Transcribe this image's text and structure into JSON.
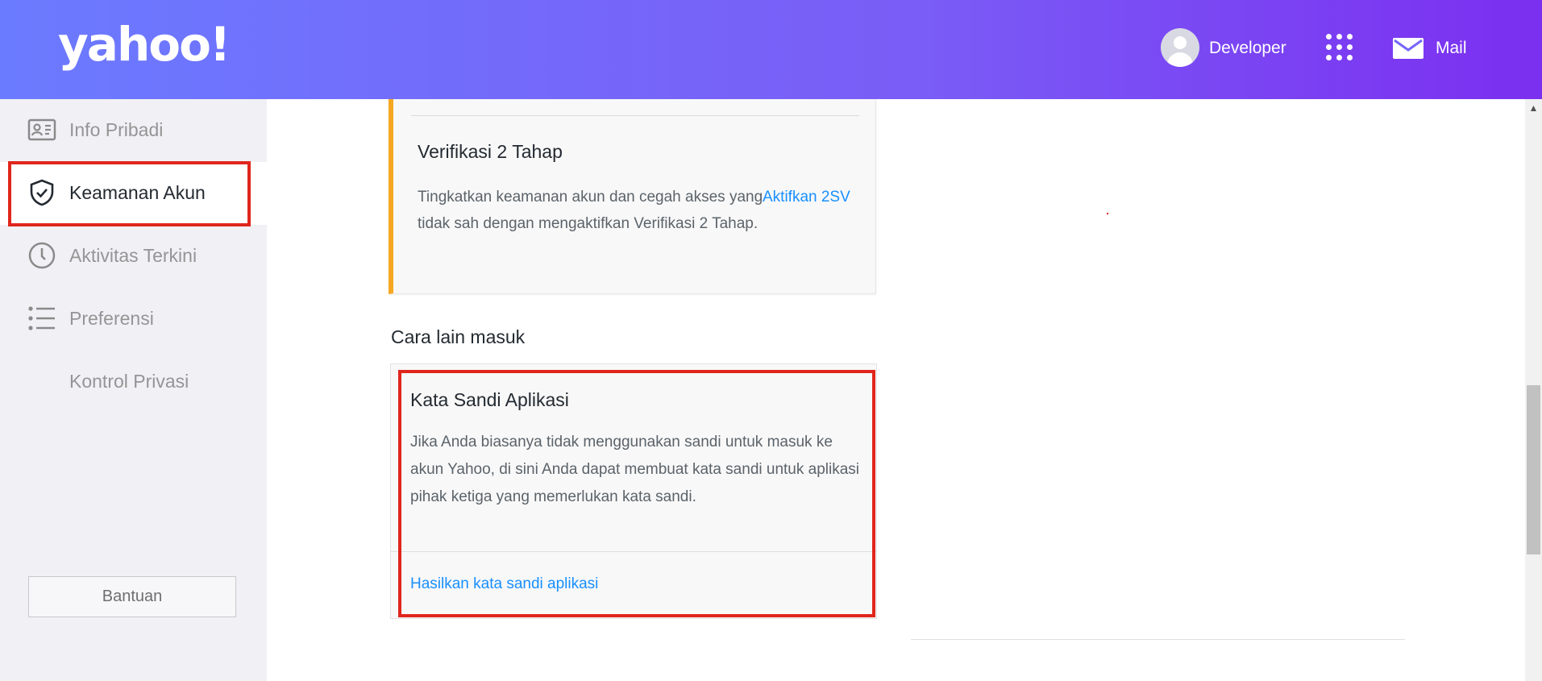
{
  "header": {
    "logo": "yahoo!",
    "user_name": "Developer",
    "apps_icon": "apps-grid-icon",
    "mail_label": "Mail",
    "gradient": [
      "#6b7bff",
      "#7b2ff0"
    ]
  },
  "sidebar": {
    "items": [
      {
        "label": "Info Pribadi",
        "icon": "id-card-icon",
        "active": false
      },
      {
        "label": "Keamanan Akun",
        "icon": "shield-check-icon",
        "active": true
      },
      {
        "label": "Aktivitas Terkini",
        "icon": "clock-icon",
        "active": false
      },
      {
        "label": "Preferensi",
        "icon": "list-icon",
        "active": false
      },
      {
        "label": "Kontrol Privasi",
        "icon": "",
        "active": false
      }
    ],
    "help_label": "Bantuan"
  },
  "two_step": {
    "title": "Verifikasi 2 Tahap",
    "description": "Tingkatkan keamanan akun dan cegah akses yang tidak sah dengan mengaktifkan Verifikasi 2 Tahap.",
    "action_label": "Aktifkan 2SV",
    "accent_color": "#f7a823"
  },
  "other_signin": {
    "section_title": "Cara lain masuk",
    "app_password": {
      "title": "Kata Sandi Aplikasi",
      "description": "Jika Anda biasanya tidak menggunakan sandi untuk masuk ke akun Yahoo, di sini Anda dapat membuat kata sandi untuk aplikasi pihak ketiga yang memerlukan kata sandi.",
      "action_label": "Hasilkan kata sandi aplikasi"
    }
  },
  "colors": {
    "link": "#188fff",
    "highlight": "#e0261c"
  }
}
